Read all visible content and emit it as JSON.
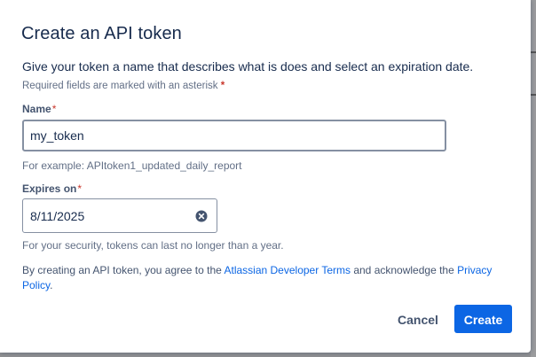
{
  "dialog": {
    "title": "Create an API token",
    "description": "Give your token a name that describes what is does and select an expiration date.",
    "required_note": "Required fields are marked with an asterisk",
    "required_marker": "*"
  },
  "name_field": {
    "label": "Name",
    "value": "my_token",
    "helper": "For example: APItoken1_updated_daily_report"
  },
  "expires_field": {
    "label": "Expires on",
    "value": "8/11/2025",
    "clear_icon": "clear-circle-icon",
    "helper": "For your security, tokens can last no longer than a year."
  },
  "terms": {
    "prefix": "By creating an API token, you agree to the ",
    "developer_terms_link": "Atlassian Developer Terms",
    "middle": " and acknowledge the ",
    "privacy_policy_link": "Privacy Policy",
    "suffix": "."
  },
  "actions": {
    "cancel_label": "Cancel",
    "create_label": "Create"
  },
  "colors": {
    "primary": "#0c66e4",
    "text": "#172b4d",
    "subtle_text": "#626f86",
    "required": "#c9372c",
    "overlay": "#8f9092"
  }
}
